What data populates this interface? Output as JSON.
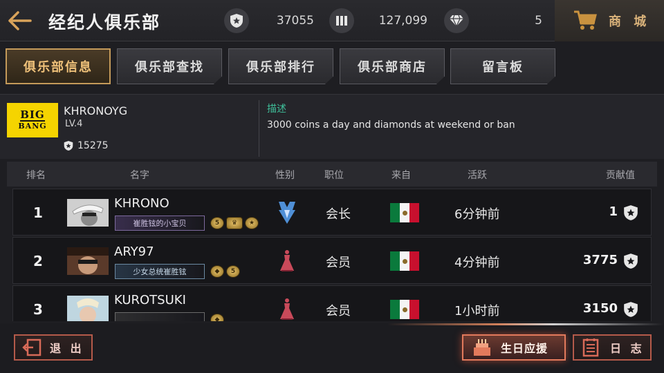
{
  "header": {
    "title": "经纪人俱乐部",
    "stats": [
      {
        "icon": "shield-icon",
        "value": "37055"
      },
      {
        "icon": "ticket-icon",
        "value": "127,099"
      },
      {
        "icon": "diamond-icon",
        "value": "5"
      }
    ],
    "shop_label": "商 城"
  },
  "tabs": [
    {
      "label": "俱乐部信息",
      "active": true
    },
    {
      "label": "俱乐部查找",
      "active": false
    },
    {
      "label": "俱乐部排行",
      "active": false
    },
    {
      "label": "俱乐部商店",
      "active": false
    },
    {
      "label": "留言板",
      "active": false
    }
  ],
  "club": {
    "logo_text_top": "BIG",
    "logo_text_bottom": "BANG",
    "name": "KHRONOYG",
    "level": "LV.4",
    "points": "15275",
    "desc_label": "描述",
    "description": "3000 coins a day and diamonds at weekend or ban"
  },
  "table": {
    "headers": {
      "rank": "排名",
      "name": "名字",
      "gender": "性别",
      "role": "职位",
      "from": "来自",
      "active": "活跃",
      "contrib": "贡献值"
    },
    "rows": [
      {
        "rank": "1",
        "name": "KHRONO",
        "title": "崔胜铉的小宝贝",
        "role": "会长",
        "active": "6分钟前",
        "contrib": "1",
        "gender": "male"
      },
      {
        "rank": "2",
        "name": "ARY97",
        "title": "少女总统崔胜铉",
        "role": "会员",
        "active": "4分钟前",
        "contrib": "3775",
        "gender": "female"
      },
      {
        "rank": "3",
        "name": "KUROTSUKI",
        "title": "",
        "role": "会员",
        "active": "1小时前",
        "contrib": "3150",
        "gender": "female"
      }
    ]
  },
  "footer": {
    "exit_label": "退 出",
    "birthday_label": "生日应援",
    "log_label": "日 志"
  },
  "colors": {
    "accent_gold": "#c49a5a",
    "desc_green": "#3fbf9a",
    "button_red": "#b45a4a",
    "flag_green": "#0a7a3c",
    "flag_red": "#c8102e"
  }
}
